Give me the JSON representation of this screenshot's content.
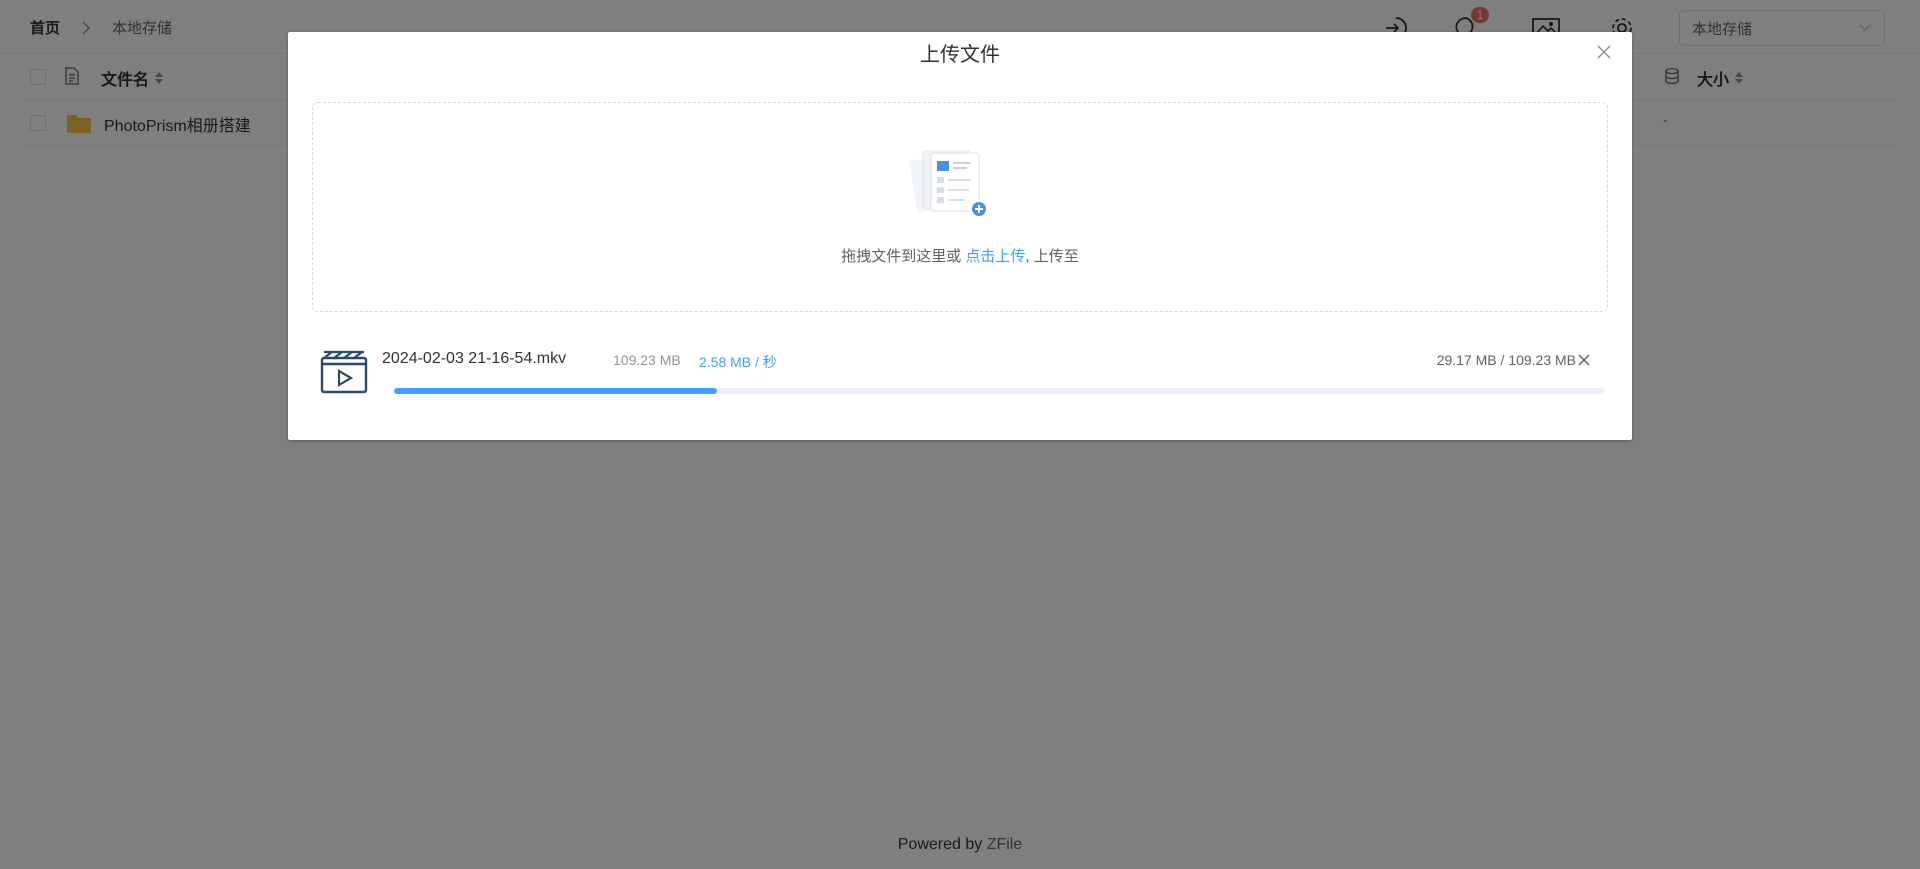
{
  "header": {
    "breadcrumb_home": "首页",
    "breadcrumb_current": "本地存储",
    "notification_count": "1",
    "storage_select_value": "本地存储"
  },
  "table": {
    "col_name": "文件名",
    "col_size": "大小",
    "rows": [
      {
        "name": "PhotoPrism相册搭建",
        "size": "-"
      }
    ]
  },
  "dialog": {
    "title": "上传文件",
    "dropzone_text": "拖拽文件到这里或 ",
    "dropzone_link": "点击上传",
    "dropzone_suffix": ", 上传至",
    "upload": {
      "file_name": "2024-02-03 21-16-54.mkv",
      "file_size": "109.23 MB",
      "speed": "2.58 MB / 秒",
      "progress_text": "29.17 MB / 109.23 MB",
      "progress_fraction": 0.267
    }
  },
  "footer": {
    "prefix": "Powered by ",
    "brand": "ZFile"
  },
  "colors": {
    "accent": "#409eff",
    "folder": "#f3c13a",
    "badge": "#f56c6c",
    "overlay": "rgba(0,0,0,0.5)"
  },
  "icons": [
    "chevron-right-icon",
    "login-icon",
    "chat-icon",
    "gallery-icon",
    "gear-icon",
    "chevron-down-icon",
    "file-icon",
    "database-icon",
    "folder-icon",
    "close-icon",
    "upload-illustration-icon",
    "video-file-icon"
  ]
}
